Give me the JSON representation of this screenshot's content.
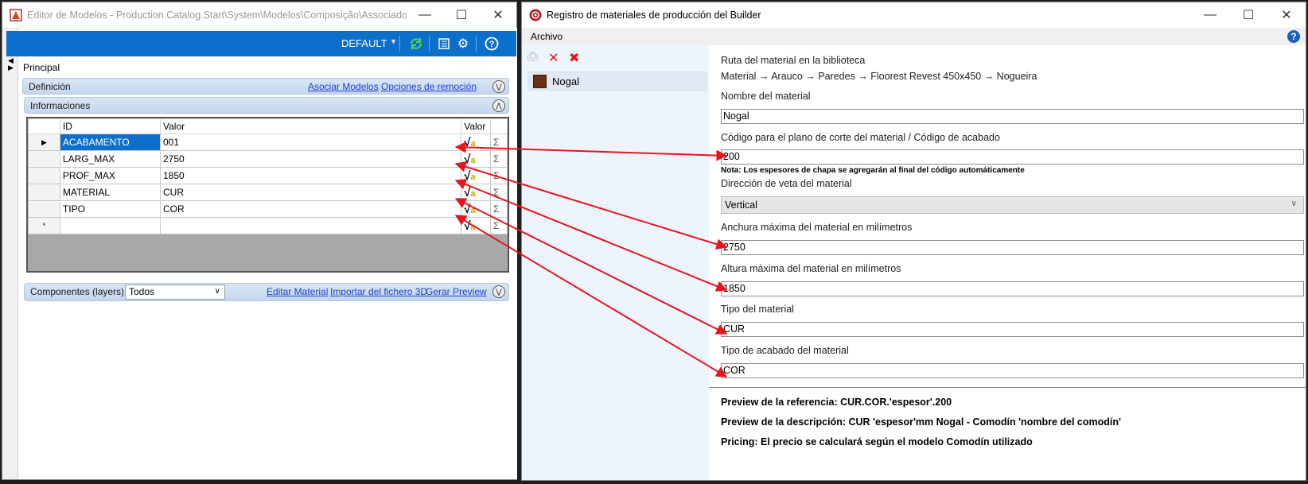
{
  "left_window": {
    "title": "Editor de Modelos - Production.Catalog.Start\\System\\Modelos\\Composição\\Associado C...",
    "toolbar": {
      "profile": "DEFAULT"
    },
    "principal": "Principal",
    "definicion": {
      "title": "Definición",
      "link_asociar": "Asociar Modelos",
      "link_opciones": "Opciones de remoción"
    },
    "informaciones": {
      "title": "Informaciones",
      "columns": [
        "ID",
        "Valor",
        "Valor"
      ],
      "rows": [
        {
          "id": "ACABAMENTO",
          "value": "001"
        },
        {
          "id": "LARG_MAX",
          "value": "2750"
        },
        {
          "id": "PROF_MAX",
          "value": "1850"
        },
        {
          "id": "MATERIAL",
          "value": "CUR"
        },
        {
          "id": "TIPO",
          "value": "COR"
        }
      ],
      "new_row_marker": "*"
    },
    "componentes": {
      "title": "Componentes (layers)",
      "filter_value": "Todos",
      "link_editar": "Editar Material",
      "link_importar": "Importar del fichero 3D",
      "link_preview": "Gerar Preview"
    }
  },
  "right_window": {
    "title": "Registro de materiales de producción del Builder",
    "menu": {
      "archivo": "Archivo"
    },
    "materials_list": [
      {
        "name": "Nogal",
        "color": "#6b2f12"
      }
    ],
    "form": {
      "ruta_label": "Ruta del material en la biblioteca",
      "ruta_value": "Material → Arauco → Paredes → Floorest Revest 450x450 → Nogueira",
      "nombre_label": "Nombre del material",
      "nombre_value": "Nogal",
      "codigo_label": "Código para el plano de corte del material / Código de acabado",
      "codigo_value": "200",
      "nota": "Nota: Los espesores de chapa se agregarán al final del código automáticamente",
      "direccion_label": "Dirección de veta del material",
      "direccion_value": "Vertical",
      "anchura_label": "Anchura máxima del material en milímetros",
      "anchura_value": "2750",
      "altura_label": "Altura máxima del material en milímetros",
      "altura_value": "1850",
      "tipo_label": "Tipo del material",
      "tipo_value": "CUR",
      "acabado_label": "Tipo de acabado del material",
      "acabado_value": "COR"
    },
    "preview": {
      "referencia": "Preview de la referencia: CUR.COR.'espesor'.200",
      "descripcion": "Preview de la descripción: CUR 'espesor'mm Nogal - Comodín 'nombre del comodín'",
      "pricing": "Pricing: El precio se calculará según el modelo Comodín utilizado"
    }
  },
  "colors": {
    "toolbar_blue": "#0d6fcc",
    "arrow_red": "#e8141c",
    "swatch": "#6b2f12"
  }
}
